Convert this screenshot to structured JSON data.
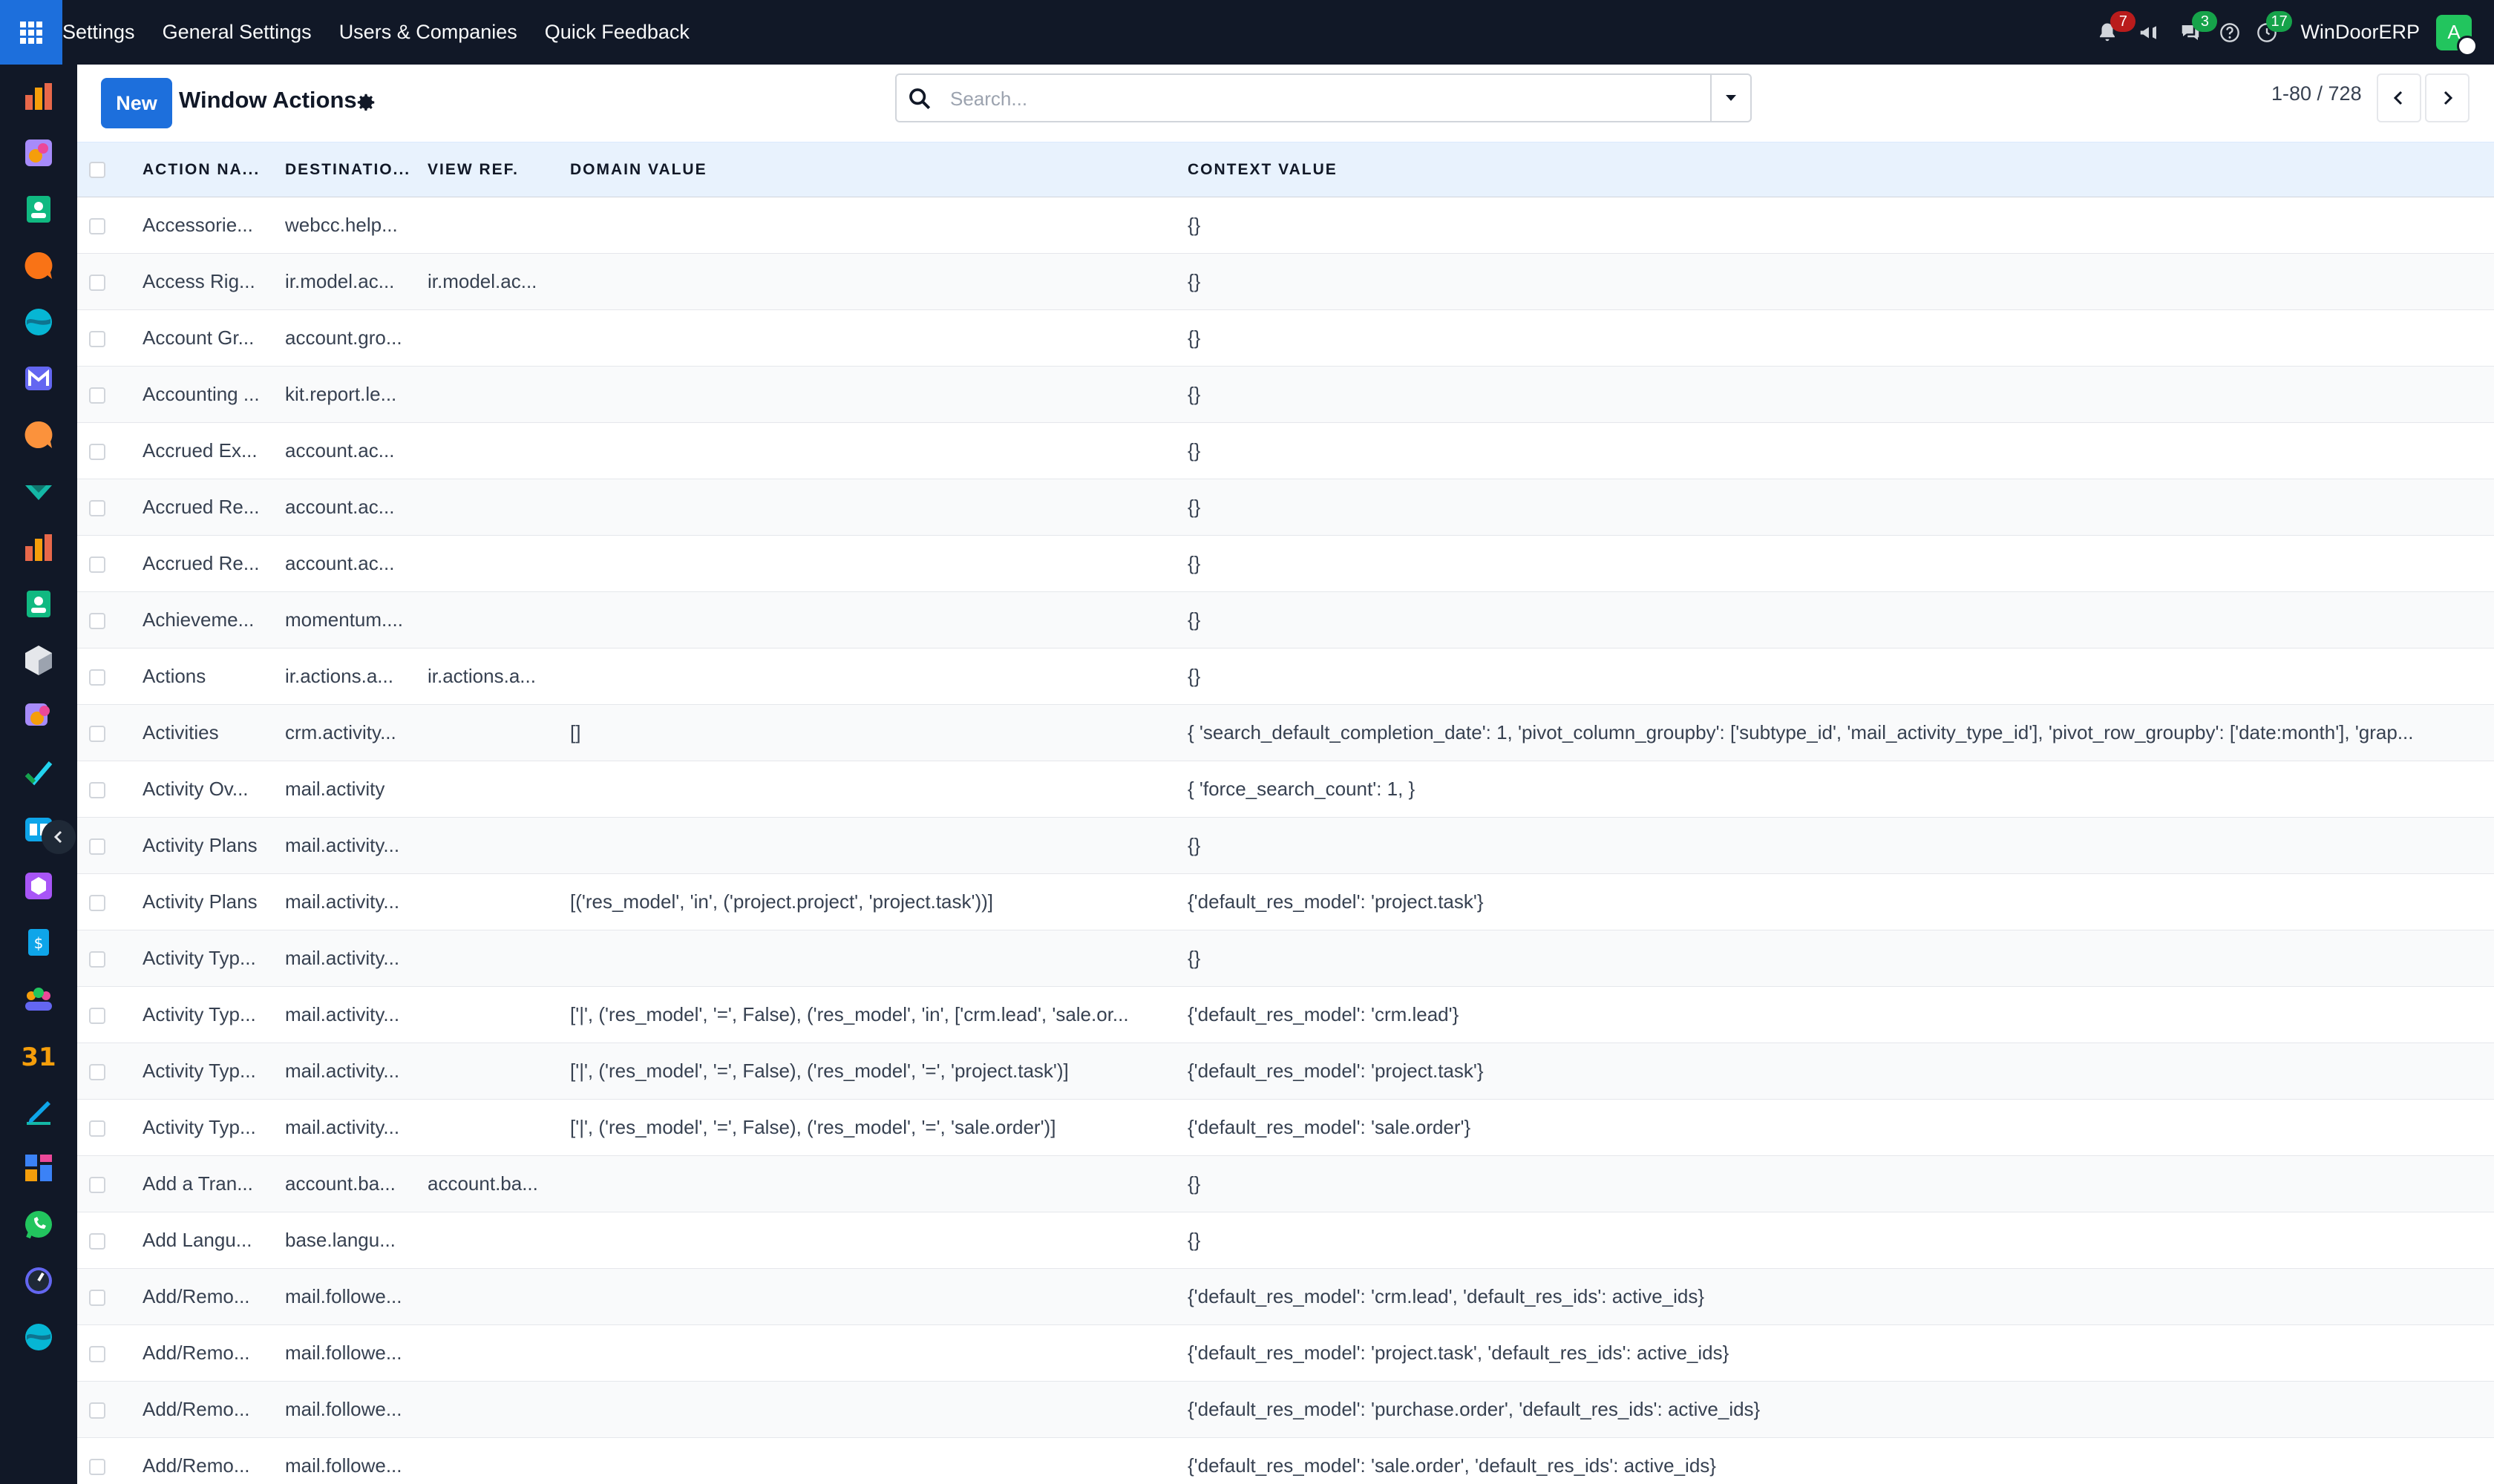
{
  "navbar": {
    "menu": [
      "Settings",
      "General Settings",
      "Users & Companies",
      "Quick Feedback"
    ],
    "notifications_count": "7",
    "messages_count": "3",
    "activities_count": "17",
    "company_name": "WinDoorERP",
    "avatar_letter": "A"
  },
  "control_panel": {
    "new_label": "New",
    "title": "Window Actions",
    "search_placeholder": "Search...",
    "pager_value": "1-80 / 728"
  },
  "table": {
    "headers": [
      "ACTION NA...",
      "DESTINATIO...",
      "VIEW REF.",
      "DOMAIN VALUE",
      "CONTEXT VALUE"
    ],
    "rows": [
      [
        "Accessorie...",
        "webcc.help...",
        "",
        "",
        "{}"
      ],
      [
        "Access Rig...",
        "ir.model.ac...",
        "ir.model.ac...",
        "",
        "{}"
      ],
      [
        "Account Gr...",
        "account.gro...",
        "",
        "",
        "{}"
      ],
      [
        "Accounting ...",
        "kit.report.le...",
        "",
        "",
        "{}"
      ],
      [
        "Accrued Ex...",
        "account.ac...",
        "",
        "",
        "{}"
      ],
      [
        "Accrued Re...",
        "account.ac...",
        "",
        "",
        "{}"
      ],
      [
        "Accrued Re...",
        "account.ac...",
        "",
        "",
        "{}"
      ],
      [
        "Achieveme...",
        "momentum....",
        "",
        "",
        "{}"
      ],
      [
        "Actions",
        "ir.actions.a...",
        "ir.actions.a...",
        "",
        "{}"
      ],
      [
        "Activities",
        "crm.activity...",
        "",
        "[]",
        "{ 'search_default_completion_date': 1, 'pivot_column_groupby': ['subtype_id', 'mail_activity_type_id'], 'pivot_row_groupby': ['date:month'], 'grap..."
      ],
      [
        "Activity Ov...",
        "mail.activity",
        "",
        "",
        "{ 'force_search_count': 1, }"
      ],
      [
        "Activity Plans",
        "mail.activity...",
        "",
        "",
        "{}"
      ],
      [
        "Activity Plans",
        "mail.activity...",
        "",
        "[('res_model', 'in', ('project.project', 'project.task'))]",
        "{'default_res_model': 'project.task'}"
      ],
      [
        "Activity Typ...",
        "mail.activity...",
        "",
        "",
        "{}"
      ],
      [
        "Activity Typ...",
        "mail.activity...",
        "",
        "['|', ('res_model', '=', False), ('res_model', 'in', ['crm.lead', 'sale.or...",
        "{'default_res_model': 'crm.lead'}"
      ],
      [
        "Activity Typ...",
        "mail.activity...",
        "",
        "['|', ('res_model', '=', False), ('res_model', '=', 'project.task')]",
        "{'default_res_model': 'project.task'}"
      ],
      [
        "Activity Typ...",
        "mail.activity...",
        "",
        "['|', ('res_model', '=', False), ('res_model', '=', 'sale.order')]",
        "{'default_res_model': 'sale.order'}"
      ],
      [
        "Add a Tran...",
        "account.ba...",
        "account.ba...",
        "",
        "{}"
      ],
      [
        "Add Langu...",
        "base.langu...",
        "",
        "",
        "{}"
      ],
      [
        "Add/Remo...",
        "mail.followe...",
        "",
        "",
        "{'default_res_model': 'crm.lead', 'default_res_ids': active_ids}"
      ],
      [
        "Add/Remo...",
        "mail.followe...",
        "",
        "",
        "{'default_res_model': 'project.task', 'default_res_ids': active_ids}"
      ],
      [
        "Add/Remo...",
        "mail.followe...",
        "",
        "",
        "{'default_res_model': 'purchase.order', 'default_res_ids': active_ids}"
      ],
      [
        "Add/Remo...",
        "mail.followe...",
        "",
        "",
        "{'default_res_model': 'sale.order', 'default_res_ids': active_ids}"
      ]
    ]
  },
  "sidebar_apps": [
    "invoicing-icon",
    "studio-icon",
    "contacts-icon",
    "discuss-icon",
    "sales-icon",
    "email-marketing-icon",
    "livechat-icon",
    "surveys-icon",
    "reporting-icon",
    "employees-icon",
    "inventory-icon",
    "apps-icon",
    "project-icon",
    "knowledge-icon",
    "products-icon",
    "expenses-icon",
    "team-icon",
    "calendar-icon",
    "sign-icon",
    "dashboards-icon",
    "whatsapp-icon",
    "timesheets-icon",
    "website-icon"
  ],
  "colors": {
    "navbar_bg": "#111827",
    "accent": "#1d6fdc",
    "header_row_bg": "#e8f2fd",
    "badge_red": "#b91c1c",
    "badge_green": "#16a34a"
  }
}
